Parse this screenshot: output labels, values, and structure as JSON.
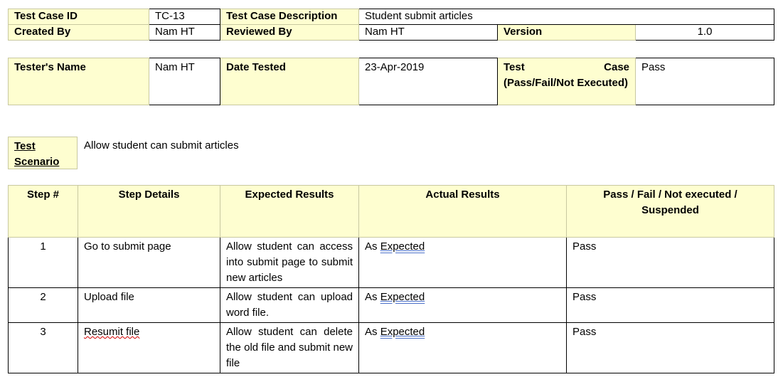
{
  "header": {
    "test_case_id_label": "Test Case ID",
    "test_case_id": "TC-13",
    "description_label": "Test Case Description",
    "description": "Student submit articles",
    "created_by_label": "Created By",
    "created_by": "Nam HT",
    "reviewed_by_label": "Reviewed By",
    "reviewed_by": "Nam HT",
    "version_label": "Version",
    "version": "1.0"
  },
  "tester": {
    "name_label": "Tester's Name",
    "name": "Nam HT",
    "date_label": "Date Tested",
    "date": "23-Apr-2019",
    "result_label_1": "Test",
    "result_label_2": "Case",
    "result_label_rest": "(Pass/Fail/Not Executed)",
    "result": "Pass"
  },
  "scenario": {
    "label": "Test Scenario",
    "text": "Allow student can submit articles"
  },
  "steps": {
    "columns": [
      "Step #",
      "Step Details",
      "Expected Results",
      "Actual Results",
      "Pass / Fail / Not executed / Suspended"
    ],
    "rows": [
      {
        "num": "1",
        "details": "Go to submit page",
        "expected": "Allow student can access into submit page to submit new articles",
        "actual_prefix": "As",
        "actual_link": "Expected",
        "status": "Pass"
      },
      {
        "num": "2",
        "details": "Upload file",
        "expected": "Allow student can upload word file.",
        "actual_prefix": "As",
        "actual_link": "Expected",
        "status": "Pass"
      },
      {
        "num": "3",
        "details": "Resumit file",
        "expected": "Allow student can delete the old file and submit new file",
        "actual_prefix": "As",
        "actual_link": "Expected",
        "status": "Pass"
      }
    ]
  }
}
